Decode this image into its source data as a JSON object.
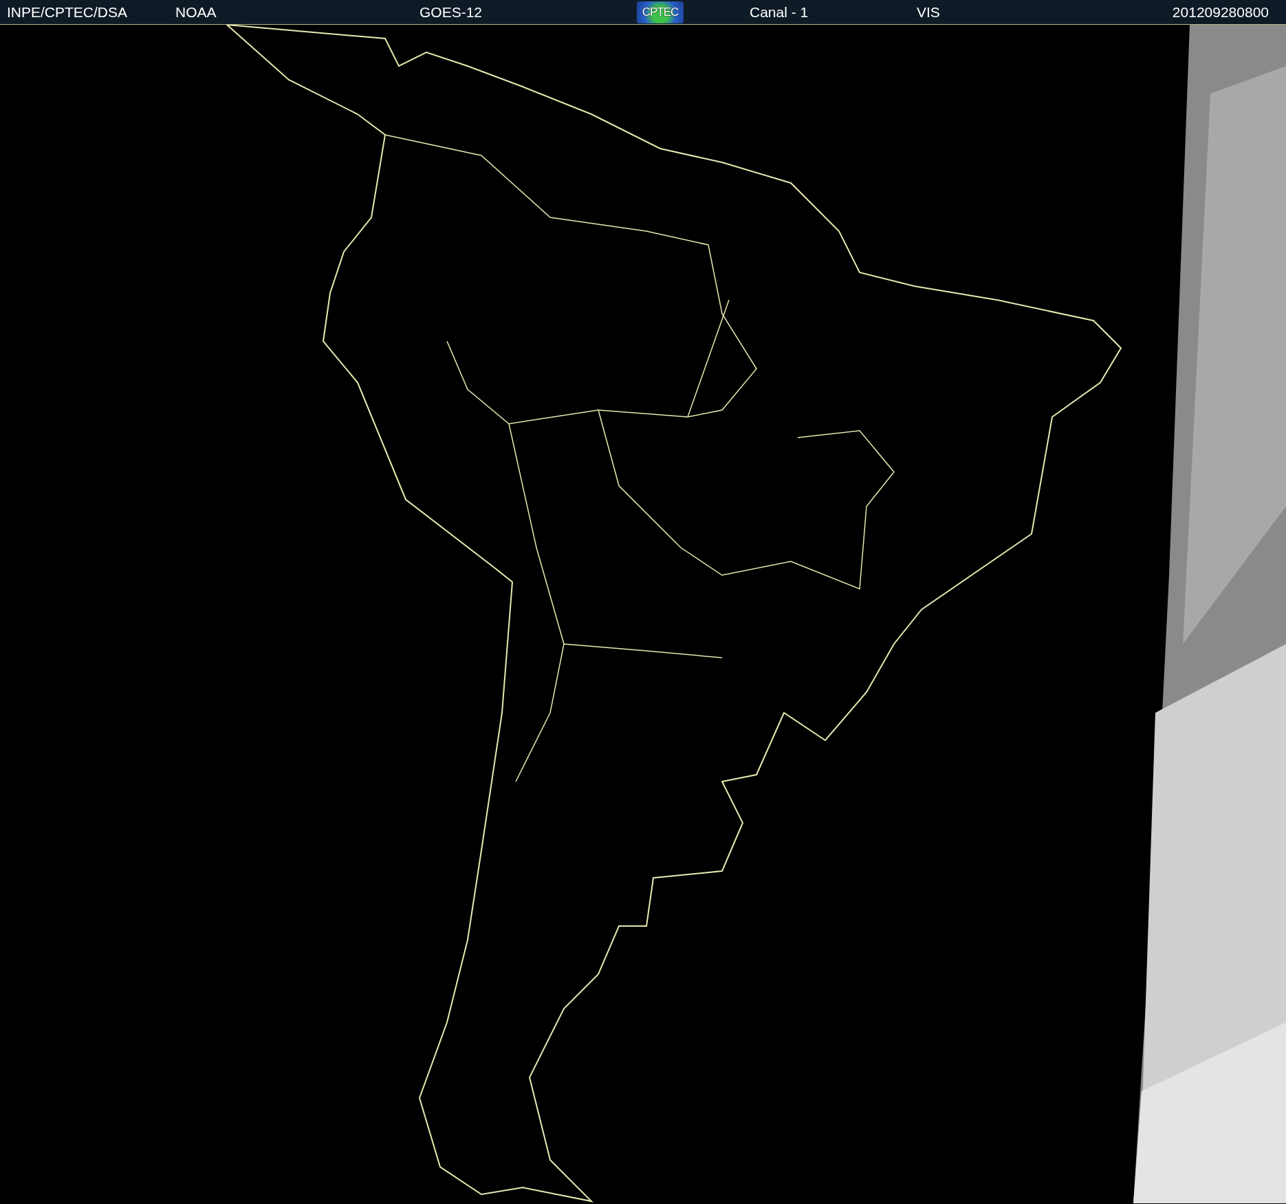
{
  "header": {
    "labels": [
      "INPE/CPTEC/DSA",
      "NOAA",
      "GOES-12"
    ],
    "logo": "CPTEC",
    "channel": "Canal - 1",
    "band": "VIS",
    "timestamp": "201209280800"
  }
}
